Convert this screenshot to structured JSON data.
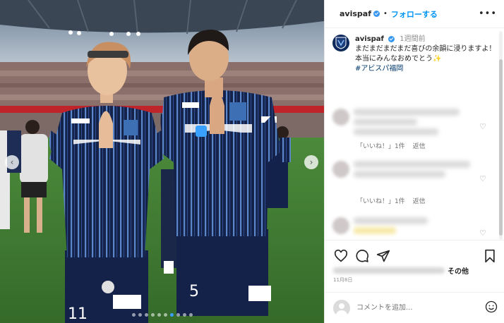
{
  "header": {
    "username": "avispaf",
    "separator": "•",
    "follow_label": "フォローする",
    "more_label": "•••"
  },
  "caption": {
    "username": "avispaf",
    "time": "1週間前",
    "line1": "まだまだまだまだ喜びの余韻に浸りますよ！",
    "line2": "本当にみんなおめでとう✨",
    "hashtag": "#アビスパ福岡"
  },
  "comments": [
    {
      "likes": "「いいね！」1件",
      "reply": "返信"
    },
    {
      "likes": "「いいね！」1件",
      "reply": "返信"
    }
  ],
  "likes": {
    "others": "その他"
  },
  "post_date": "11月8日",
  "add_comment": {
    "placeholder": "コメントを追加..."
  },
  "carousel": {
    "prev": "‹",
    "next": "›",
    "slides": 10,
    "active_index": 6
  },
  "colors": {
    "accent": "#0095f6",
    "verified": "#3897f0",
    "kit_navy": "#15234a",
    "pitch_green": "#3f7a32"
  },
  "icons": [
    "heart-icon",
    "comment-icon",
    "share-icon",
    "bookmark-icon",
    "emoji-icon",
    "more-icon",
    "verified-icon"
  ]
}
